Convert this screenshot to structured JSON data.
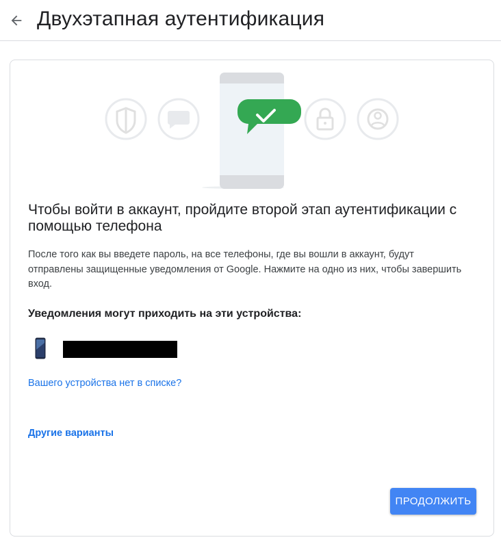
{
  "header": {
    "title": "Двухэтапная аутентификация"
  },
  "icons": {
    "back": "arrow-back-icon",
    "illustration": [
      "shield-icon",
      "chat-bubble-icon",
      "phone-icon",
      "checkmark-icon",
      "lock-icon",
      "account-icon"
    ],
    "device": "smartphone-icon"
  },
  "main": {
    "headline": "Чтобы войти в аккаунт, пройдите второй этап аутентификации с помощью телефона",
    "description": "После того как вы введете пароль, на все телефоны, где вы вошли в аккаунт, будут отправлены защищенные уведомления от Google. Нажмите на одно из них, чтобы завершить вход.",
    "devices_title": "Уведомления могут приходить на эти устройства:",
    "device_missing_link": "Вашего устройства нет в списке?",
    "other_options_link": "Другие варианты",
    "continue_button": "ПРОДОЛЖИТЬ"
  },
  "colors": {
    "accent": "#4285f4",
    "link": "#1a73e8",
    "check_bubble": "#34a853",
    "illustration_gray": "#e8eaed"
  }
}
